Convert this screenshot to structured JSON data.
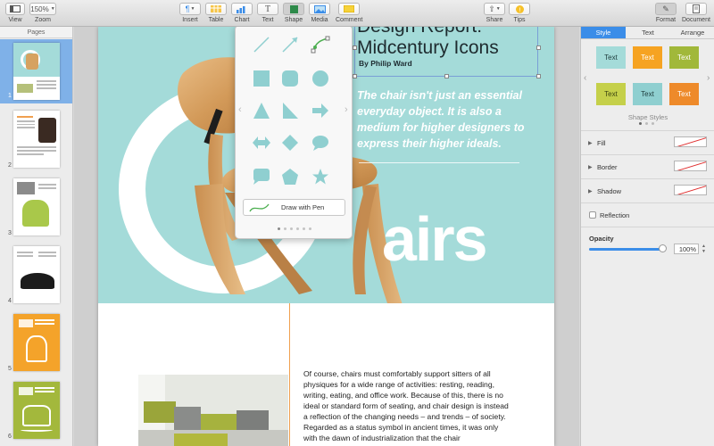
{
  "toolbar": {
    "left": [
      {
        "key": "view",
        "label": "View",
        "icon": "sidebar-view-icon"
      },
      {
        "key": "zoom",
        "label": "Zoom",
        "value": "150%",
        "icon": "chevron-down-icon"
      }
    ],
    "center": [
      {
        "key": "insert",
        "label": "Insert",
        "icon": "paragraph-icon"
      },
      {
        "key": "table",
        "label": "Table",
        "icon": "table-icon"
      },
      {
        "key": "chart",
        "label": "Chart",
        "icon": "chart-icon"
      },
      {
        "key": "text",
        "label": "Text",
        "icon": "text-icon"
      },
      {
        "key": "shape",
        "label": "Shape",
        "icon": "shape-icon"
      },
      {
        "key": "media",
        "label": "Media",
        "icon": "media-icon"
      },
      {
        "key": "comment",
        "label": "Comment",
        "icon": "comment-icon"
      }
    ],
    "right": [
      {
        "key": "share",
        "label": "Share",
        "icon": "share-icon"
      },
      {
        "key": "tips",
        "label": "Tips",
        "icon": "lightbulb-icon"
      },
      {
        "key": "format",
        "label": "Format",
        "icon": "paintbrush-icon"
      },
      {
        "key": "document",
        "label": "Document",
        "icon": "document-icon"
      }
    ]
  },
  "pages_panel": {
    "header": "Pages",
    "thumbnails": [
      {
        "num": "1",
        "selected": true
      },
      {
        "num": "2",
        "selected": false
      },
      {
        "num": "3",
        "selected": false
      },
      {
        "num": "4",
        "selected": false
      },
      {
        "num": "5",
        "selected": false
      },
      {
        "num": "6",
        "selected": false
      }
    ]
  },
  "document": {
    "title_line1": "Design Report:",
    "title_line2": "Midcentury Icons",
    "byline": "By Philip Ward",
    "pull_quote": "The chair isn't just an essential everyday object. It is also a medium for higher designers to express their higher ideals.",
    "big_word": "airs",
    "body_text": "Of course, chairs must comfortably support sitters of all physiques for a wide range of activities: resting, reading, writing, eating, and office work. Because of this, there is no ideal or standard form of seating, and chair design is instead a reflection of the changing needs – and trends – of society. Regarded as a status symbol in ancient times, it was only with the dawn of industrialization that the chair"
  },
  "shape_popover": {
    "shapes": [
      "line-icon",
      "arrow-line-icon",
      "curve-line-icon",
      "square-icon",
      "rounded-square-icon",
      "circle-icon",
      "triangle-icon",
      "right-triangle-icon",
      "arrow-right-icon",
      "double-arrow-icon",
      "diamond-icon",
      "speech-bubble-icon",
      "callout-square-icon",
      "pentagon-icon",
      "star-icon"
    ],
    "draw_with_pen_label": "Draw with Pen",
    "page_count": 6,
    "active_page": 0
  },
  "inspector": {
    "tabs": [
      "Style",
      "Text",
      "Arrange"
    ],
    "active_tab": "Style",
    "shape_styles": [
      {
        "label": "Text",
        "bg": "#a4dbd9",
        "color": "#1d3b3b"
      },
      {
        "label": "Text",
        "bg": "#f6a322",
        "color": "#ffffff"
      },
      {
        "label": "Text",
        "bg": "#a1b83a",
        "color": "#ffffff"
      },
      {
        "label": "Text",
        "bg": "#c5d04a",
        "color": "#3b4410"
      },
      {
        "label": "Text",
        "bg": "#8fcfd0",
        "color": "#1d3b3b"
      },
      {
        "label": "Text",
        "bg": "#ee8a2a",
        "color": "#ffffff"
      }
    ],
    "shape_styles_label": "Shape Styles",
    "fill_label": "Fill",
    "border_label": "Border",
    "shadow_label": "Shadow",
    "reflection_label": "Reflection",
    "opacity_label": "Opacity",
    "opacity_value": "100%",
    "opacity_fraction": 1.0
  },
  "colors": {
    "accent": "#3b8de8",
    "hero_teal": "#a4dbd9",
    "body_rule": "#f0a050"
  }
}
